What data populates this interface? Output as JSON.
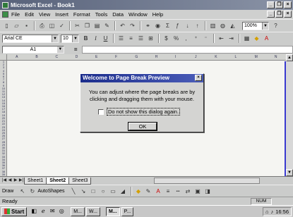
{
  "window": {
    "title": "Microsoft Excel - Book1",
    "minimize_glyph": "_",
    "restore_glyph": "❐",
    "close_glyph": "×"
  },
  "menubar": {
    "items": [
      "File",
      "Edit",
      "View",
      "Insert",
      "Format",
      "Tools",
      "Data",
      "Window",
      "Help"
    ]
  },
  "standard_toolbar": {
    "zoom": "100%",
    "icons": [
      "new-icon",
      "open-icon",
      "save-icon",
      "print-icon",
      "print-preview-icon",
      "spelling-icon",
      "cut-icon",
      "copy-icon",
      "paste-icon",
      "format-painter-icon",
      "undo-icon",
      "redo-icon",
      "hyperlink-icon",
      "web-toolbar-icon",
      "autosum-icon",
      "function-icon",
      "sort-ascending-icon",
      "sort-descending-icon",
      "chart-wizard-icon",
      "map-icon",
      "drawing-icon",
      "help-icon"
    ]
  },
  "formatting_toolbar": {
    "font": "Arial CE",
    "size": "10",
    "bold": "B",
    "italic": "I",
    "underline": "U"
  },
  "formula_bar": {
    "name_box": "A1",
    "equals": "="
  },
  "sheet": {
    "columns": [
      "A",
      "B",
      "C",
      "D",
      "E",
      "F",
      "G",
      "H",
      "I",
      "J",
      "K",
      "L",
      "M",
      "N"
    ],
    "rows": [
      "1",
      "2",
      "3",
      "4",
      "5",
      "6",
      "7",
      "8",
      "9",
      "10",
      "11",
      "12",
      "13",
      "14",
      "15",
      "16",
      "17",
      "18",
      "19",
      "20",
      "21",
      "22",
      "23",
      "24",
      "25",
      "26",
      "27",
      "28",
      "29",
      "30",
      "31",
      "32",
      "33",
      "34",
      "35",
      "36",
      "37",
      "38",
      "39"
    ]
  },
  "tabs": [
    "Sheet1",
    "Sheet2",
    "Sheet3"
  ],
  "active_tab": "Sheet2",
  "drawing_toolbar": {
    "draw": "Draw",
    "autoshapes": "AutoShapes"
  },
  "status": {
    "text": "Ready",
    "num": "NUM"
  },
  "taskbar": {
    "start": "Start",
    "buttons": [
      "M...",
      "W...",
      "M...",
      "P..."
    ],
    "active_index": 2,
    "clock": "16:56"
  },
  "dialog": {
    "title": "Welcome to Page Break Preview",
    "message_line1": "You can adjust where the page breaks are by",
    "message_line2": "clicking and dragging them with your mouse.",
    "checkbox_label": "Do not show this dialog again.",
    "ok_label": "OK"
  }
}
